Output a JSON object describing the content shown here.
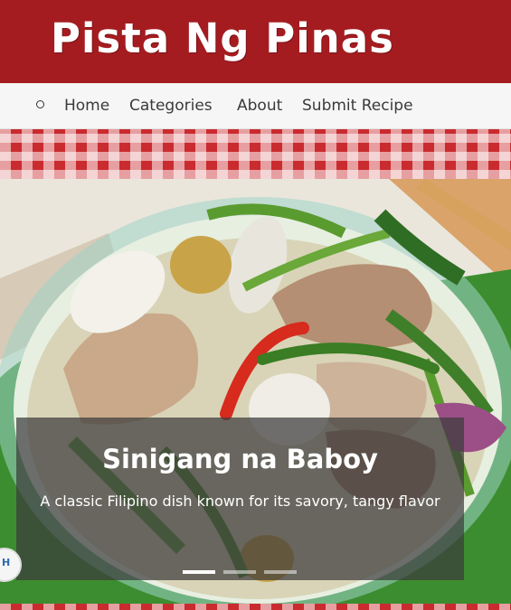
{
  "site": {
    "title": "Pista Ng Pinas"
  },
  "nav": {
    "items": [
      {
        "label": "Home"
      },
      {
        "label": "Categories"
      },
      {
        "label": "About"
      },
      {
        "label": "Submit Recipe"
      }
    ]
  },
  "hero": {
    "title": "Sinigang na Baboy",
    "description": "A classic Filipino dish known for its savory, tangy flavor",
    "slides": {
      "count": 3,
      "active": 1
    }
  },
  "badge": {
    "text": "H"
  },
  "colors": {
    "header_bg": "#a51c20",
    "nav_bg": "#f6f6f6",
    "gingham_red": "#c92b2f",
    "caption_overlay": "rgba(60,60,60,0.72)"
  }
}
